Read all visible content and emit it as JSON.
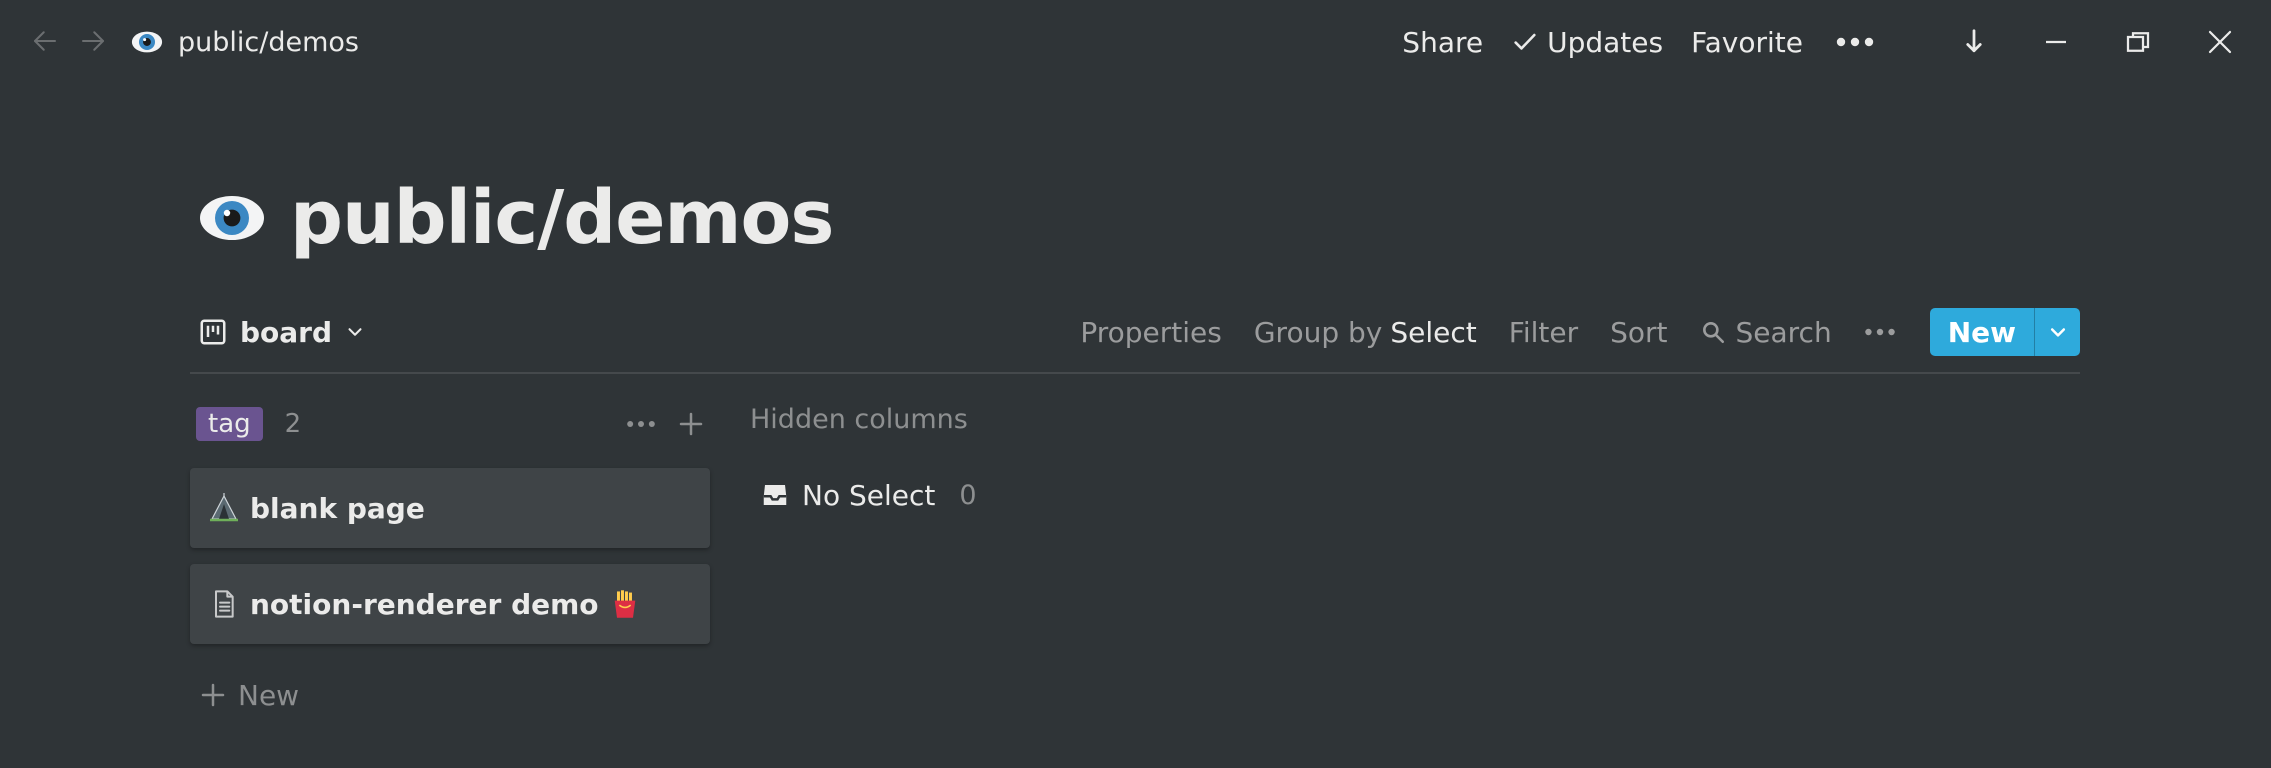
{
  "topbar": {
    "breadcrumb": "public/demos",
    "breadcrumb_icon": "eye-emoji-icon",
    "share_label": "Share",
    "updates_label": "Updates",
    "favorite_label": "Favorite"
  },
  "page": {
    "title": "public/demos",
    "icon": "eye-emoji-icon"
  },
  "db_toolbar": {
    "view_name": "board",
    "properties_label": "Properties",
    "group_by_label": "Group by",
    "group_by_value": "Select",
    "filter_label": "Filter",
    "sort_label": "Sort",
    "search_label": "Search",
    "new_label": "New"
  },
  "board": {
    "column": {
      "tag": "tag",
      "count": "2",
      "cards": [
        {
          "title": "blank page",
          "icon": "camping-icon"
        },
        {
          "title": "notion-renderer demo",
          "icon": "document-icon",
          "trailing_emoji": "fries-emoji-icon"
        }
      ],
      "add_label": "New"
    },
    "hidden": {
      "label": "Hidden columns",
      "item_label": "No Select",
      "item_count": "0"
    }
  },
  "colors": {
    "background": "#2f3437",
    "card": "#3f4447",
    "accent": "#2eaadc",
    "tag": "#6a5490"
  }
}
